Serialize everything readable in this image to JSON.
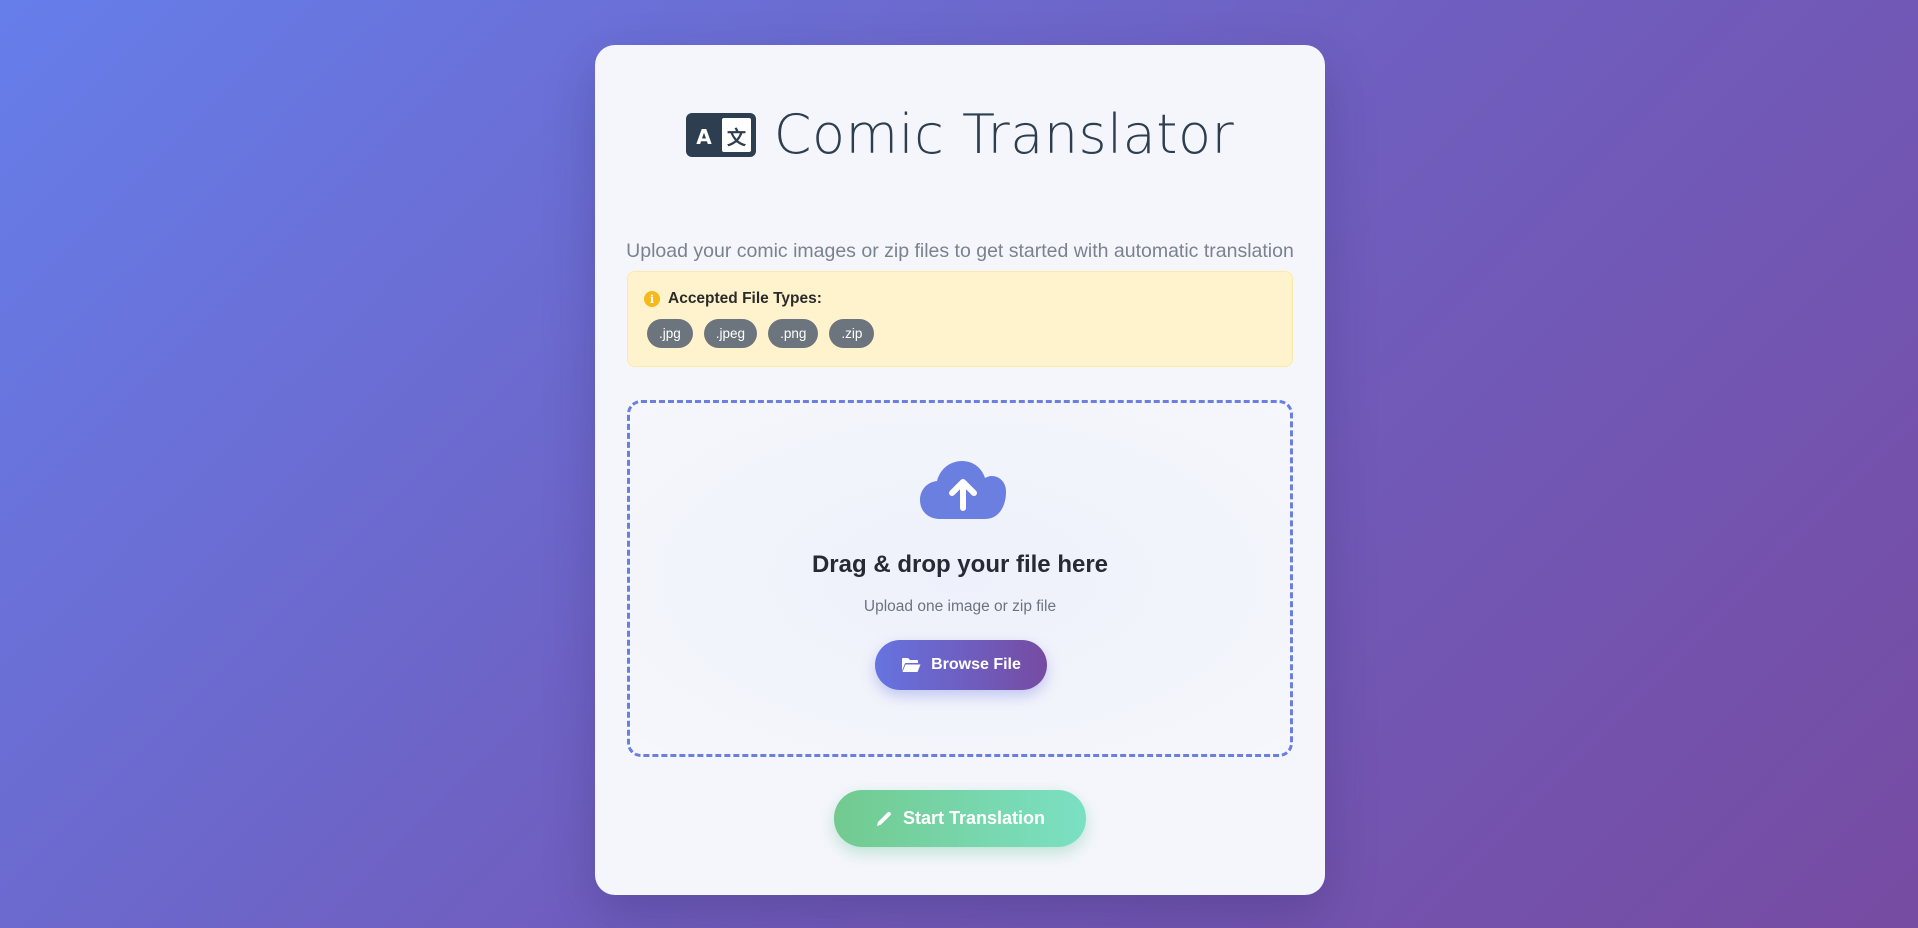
{
  "header": {
    "icon": "translate-icon",
    "title": "Comic Translator",
    "subtitle": "Upload your comic images or zip files to get started with automatic translation"
  },
  "file_types": {
    "icon": "info-icon",
    "label": "Accepted File Types:",
    "types": [
      ".jpg",
      ".jpeg",
      ".png",
      ".zip"
    ]
  },
  "dropzone": {
    "icon": "cloud-upload-icon",
    "title": "Drag & drop your file here",
    "subtitle": "Upload one image or zip file",
    "browse_icon": "folder-open-icon",
    "browse_label": "Browse File"
  },
  "actions": {
    "start_icon": "pencil-icon",
    "start_label": "Start Translation"
  },
  "colors": {
    "background_start": "#667eea",
    "background_end": "#764ba2",
    "accent": "#667eea",
    "info": "#fff3cd",
    "badge": "#6c757d",
    "success_start": "#72ca8f",
    "success_end": "#7be0c3"
  }
}
